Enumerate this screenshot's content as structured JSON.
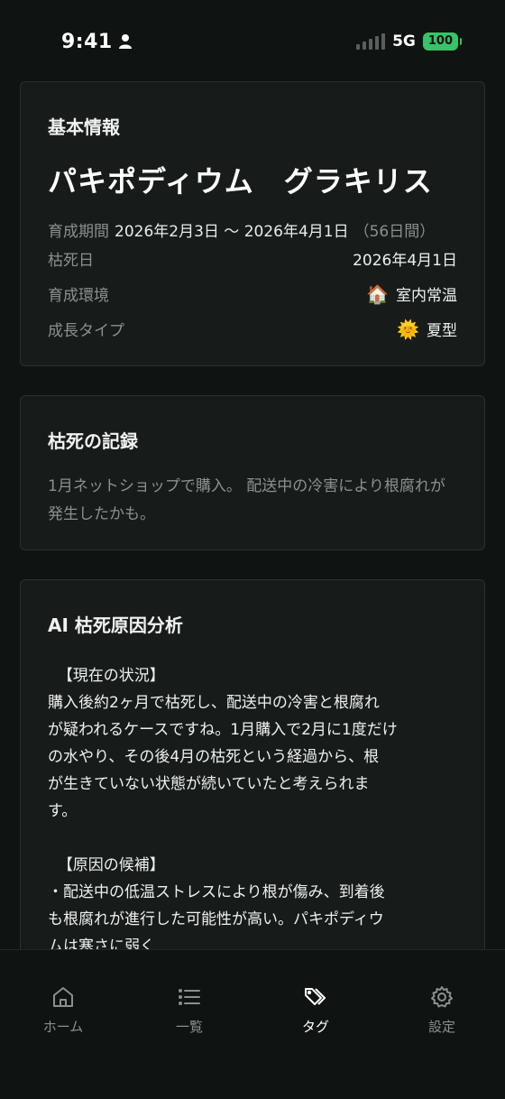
{
  "status_bar": {
    "time": "9:41",
    "network": "5G",
    "battery": "100"
  },
  "basic_info": {
    "title": "基本情報",
    "plant_name": "パキポディウム　グラキリス",
    "period_label": "育成期間",
    "period_value": "2026年2月3日 〜 2026年4月1日",
    "period_days": "（56日間）",
    "rows": [
      {
        "label": "枯死日",
        "icon": "",
        "value": "2026年4月1日"
      },
      {
        "label": "育成環境",
        "icon": "🏠",
        "value": "室内常温"
      },
      {
        "label": "成長タイプ",
        "icon": "🌞",
        "value": "夏型"
      }
    ]
  },
  "death_record": {
    "title": "枯死の記録",
    "memo": "1月ネットショップで購入。 配送中の冷害により根腐れが発生したかも。"
  },
  "ai_analysis": {
    "title": "AI 枯死原因分析",
    "body": "  【現在の状況】\n購入後約2ヶ月で枯死し、配送中の冷害と根腐れ\nが疑われるケースですね。1月購入で2月に1度だけ\nの水やり、その後4月の枯死という経過から、根\nが生きていない状態が続いていたと考えられま\nす。\n\n  【原因の候補】\n・配送中の低温ストレスにより根が傷み、到着後\nも根腐れが進行した可能性が高い。パキポディウ\nムは寒さに弱く"
  },
  "nav": {
    "items": [
      {
        "label": "ホーム",
        "icon": "home-icon"
      },
      {
        "label": "一覧",
        "icon": "list-icon"
      },
      {
        "label": "タグ",
        "icon": "tag-icon"
      },
      {
        "label": "設定",
        "icon": "gear-icon"
      }
    ],
    "active": "タグ"
  }
}
